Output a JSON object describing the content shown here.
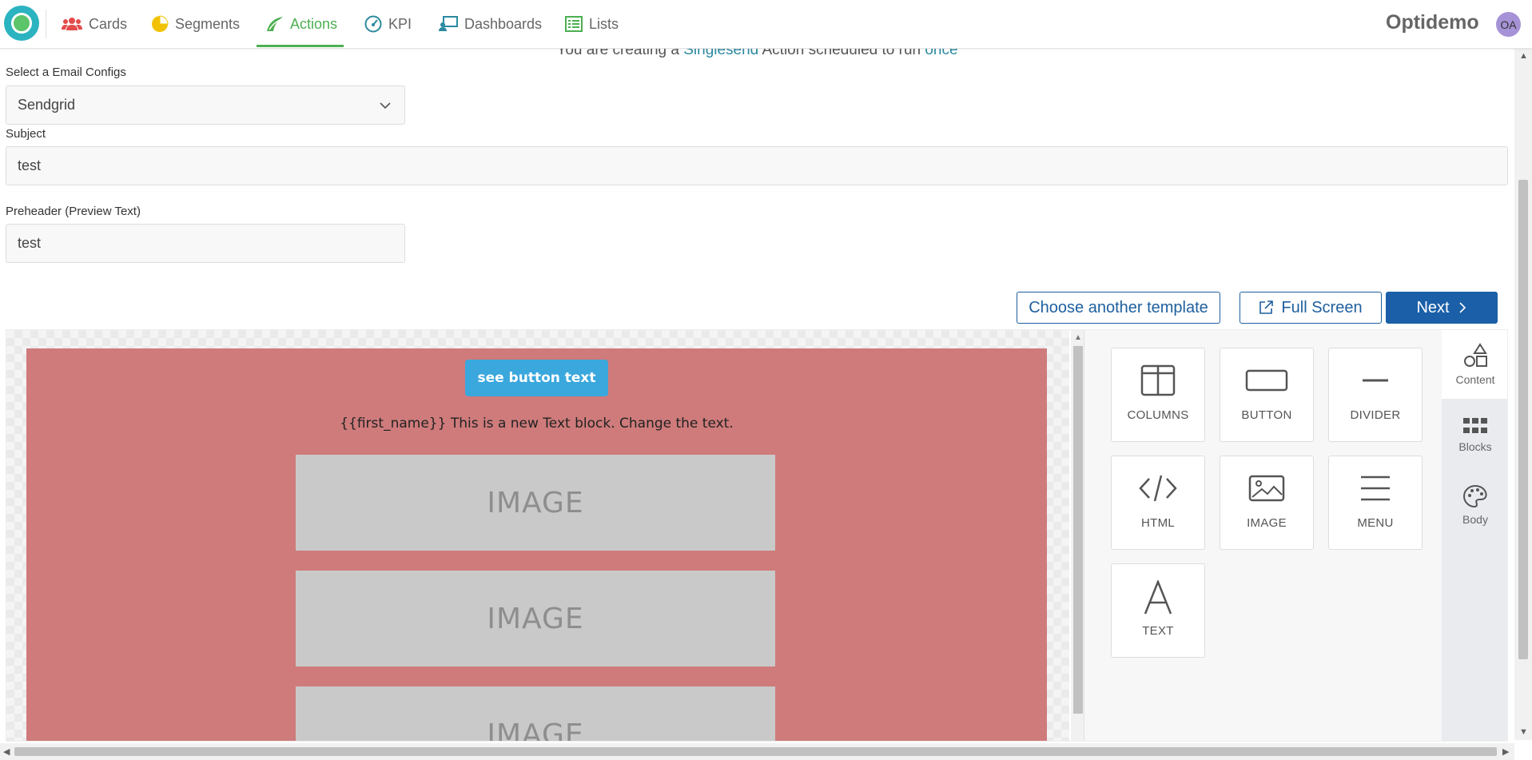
{
  "nav": {
    "items": [
      {
        "label": "Cards",
        "icon": "users-icon",
        "color": "#e54b4b"
      },
      {
        "label": "Segments",
        "icon": "pie-chart-icon",
        "color": "#f2c200"
      },
      {
        "label": "Actions",
        "icon": "send-icon",
        "color": "#4caf50",
        "active": true
      },
      {
        "label": "KPI",
        "icon": "gauge-icon",
        "color": "#2a8aa0"
      },
      {
        "label": "Dashboards",
        "icon": "presentation-icon",
        "color": "#2a8aa0"
      },
      {
        "label": "Lists",
        "icon": "list-icon",
        "color": "#4caf50"
      }
    ],
    "brand": "Optidemo",
    "avatar_initials": "OA"
  },
  "status": {
    "prefix": "You are creating a",
    "action_type": "Singlesend",
    "middle": "Action scheduled to run",
    "schedule": "once"
  },
  "form": {
    "email_config_label": "Select a Email Configs",
    "email_config_value": "Sendgrid",
    "subject_label": "Subject",
    "subject_value": "test",
    "preheader_label": "Preheader (Preview Text)",
    "preheader_value": "test"
  },
  "buttons": {
    "choose_template": "Choose another template",
    "full_screen": "Full Screen",
    "next": "Next"
  },
  "email": {
    "button_text": "see button text",
    "text_block": "{{first_name}} This is a new Text block. Change the text.",
    "image_placeholder": "IMAGE",
    "background_color": "#cf7b7b",
    "button_color": "#3aa7dd"
  },
  "tools": [
    {
      "label": "COLUMNS",
      "icon": "columns-icon"
    },
    {
      "label": "BUTTON",
      "icon": "button-icon"
    },
    {
      "label": "DIVIDER",
      "icon": "divider-icon"
    },
    {
      "label": "HTML",
      "icon": "code-icon"
    },
    {
      "label": "IMAGE",
      "icon": "image-icon"
    },
    {
      "label": "MENU",
      "icon": "menu-icon"
    },
    {
      "label": "TEXT",
      "icon": "text-icon"
    }
  ],
  "panel_tabs": [
    {
      "label": "Content",
      "icon": "shapes-icon",
      "active": true
    },
    {
      "label": "Blocks",
      "icon": "grid-icon"
    },
    {
      "label": "Body",
      "icon": "palette-icon"
    }
  ],
  "colors": {
    "accent_green": "#4caf50",
    "primary_blue": "#1a5fa8",
    "link_teal": "#2a8aa0"
  }
}
